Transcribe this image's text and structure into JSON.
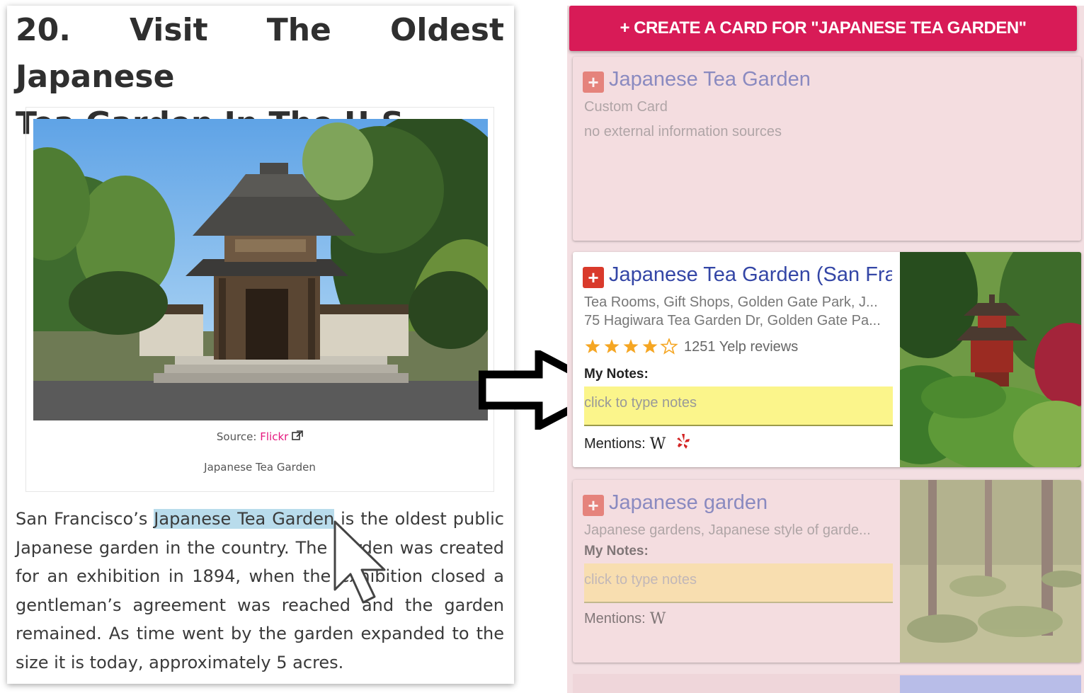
{
  "article": {
    "title_line1": "20. Visit The Oldest Japanese",
    "title_line2": "Tea Garden In The U.S",
    "photo_alt": "Japanese Tea Garden gate photo",
    "source_label": "Source: ",
    "source_link": "Flickr",
    "caption": "Japanese Tea Garden",
    "body_pre": "San Francisco’s ",
    "body_highlight": "Japanese Tea Garden",
    "body_post": " is the oldest public Japanese garden in the country. The garden was created for an exhibition in 1894, when the exhibition closed a gentleman’s agreement was reached and the garden remained. As time went by the garden expanded to the size it is today, approximately 5 acres."
  },
  "panel": {
    "create_button": "+ CREATE A CARD FOR \"JAPANESE TEA GARDEN\"",
    "cards": [
      {
        "plus": "+",
        "title": "Japanese Tea Garden",
        "sub1": "Custom Card",
        "sub2": "no external information sources"
      },
      {
        "plus": "+",
        "title": "Japanese Tea Garden (San Francisco)",
        "sub1": "Tea Rooms, Gift Shops, Golden Gate Park, J...",
        "sub2": "75 Hagiwara Tea Garden Dr, Golden Gate Pa...",
        "rating": 4,
        "rating_max": 5,
        "reviews": "1251 Yelp reviews",
        "notes_label": "My Notes:",
        "notes_placeholder": "click to type notes",
        "mentions_label": "Mentions:",
        "mention_wiki": "W"
      },
      {
        "plus": "+",
        "title": "Japanese garden",
        "sub1": "Japanese gardens, Japanese style of garde...",
        "notes_label": "My Notes:",
        "notes_placeholder": "click to type notes",
        "mentions_label": "Mentions:",
        "mention_wiki": "W"
      }
    ]
  },
  "colors": {
    "create_button_bg": "#d81b57",
    "panel_bg": "#f3dfe2",
    "title_blue": "#3446a6",
    "plus_red": "#d93a2b",
    "notes_yellow": "#fbf58b",
    "highlight": "#b9dcec",
    "star": "#f5a623",
    "yelp_red": "#d32323"
  }
}
